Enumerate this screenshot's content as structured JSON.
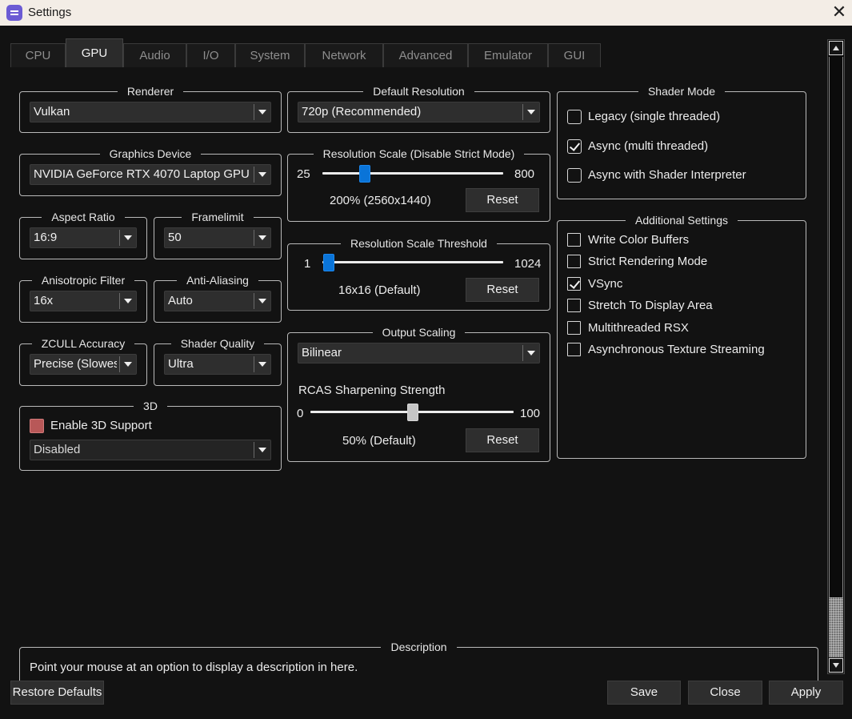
{
  "window": {
    "title": "Settings"
  },
  "tabs": [
    "CPU",
    "GPU",
    "Audio",
    "I/O",
    "System",
    "Network",
    "Advanced",
    "Emulator",
    "GUI"
  ],
  "active_tab": "GPU",
  "renderer": {
    "label": "Renderer",
    "value": "Vulkan"
  },
  "graphics_device": {
    "label": "Graphics Device",
    "value": "NVIDIA GeForce RTX 4070 Laptop GPU"
  },
  "aspect_ratio": {
    "label": "Aspect Ratio",
    "value": "16:9"
  },
  "framelimit": {
    "label": "Framelimit",
    "value": "50"
  },
  "anisotropic_filter": {
    "label": "Anisotropic Filter",
    "value": "16x"
  },
  "anti_aliasing": {
    "label": "Anti-Aliasing",
    "value": "Auto"
  },
  "zcull_accuracy": {
    "label": "ZCULL Accuracy",
    "value": "Precise (Slowest)"
  },
  "shader_quality": {
    "label": "Shader Quality",
    "value": "Ultra"
  },
  "three_d": {
    "label": "3D",
    "enable_label": "Enable 3D Support",
    "enabled": false,
    "mode_value": "Disabled"
  },
  "default_resolution": {
    "label": "Default Resolution",
    "value": "720p (Recommended)"
  },
  "resolution_scale": {
    "label": "Resolution Scale (Disable Strict Mode)",
    "min": "25",
    "max": "800",
    "value": 200,
    "value_text": "200% (2560x1440)",
    "reset_label": "Reset"
  },
  "resolution_threshold": {
    "label": "Resolution Scale Threshold",
    "min": "1",
    "max": "1024",
    "value": 16,
    "value_text": "16x16 (Default)",
    "reset_label": "Reset"
  },
  "output_scaling": {
    "label": "Output Scaling",
    "value": "Bilinear",
    "rcas_label": "RCAS Sharpening Strength",
    "min": "0",
    "max": "100",
    "value_pct": 50,
    "value_text": "50% (Default)",
    "reset_label": "Reset"
  },
  "shader_mode": {
    "label": "Shader Mode",
    "options": [
      {
        "label": "Legacy (single threaded)",
        "checked": false
      },
      {
        "label": "Async (multi threaded)",
        "checked": true
      },
      {
        "label": "Async with Shader Interpreter",
        "checked": false
      }
    ]
  },
  "additional_settings": {
    "label": "Additional Settings",
    "items": [
      {
        "label": "Write Color Buffers",
        "checked": false
      },
      {
        "label": "Strict Rendering Mode",
        "checked": false
      },
      {
        "label": "VSync",
        "checked": true
      },
      {
        "label": "Stretch To Display Area",
        "checked": false
      },
      {
        "label": "Multithreaded RSX",
        "checked": false
      },
      {
        "label": "Asynchronous Texture Streaming",
        "checked": false
      }
    ]
  },
  "description": {
    "label": "Description",
    "text": "Point your mouse at an option to display a description in here."
  },
  "footer": {
    "restore_label": "Restore Defaults",
    "save_label": "Save",
    "close_label": "Close",
    "apply_label": "Apply"
  },
  "icons": [
    "app-icon",
    "close-icon",
    "scroll-up-arrow-icon",
    "scroll-down-arrow-icon",
    "dropdown-arrow-icon",
    "checkbox-icon"
  ]
}
